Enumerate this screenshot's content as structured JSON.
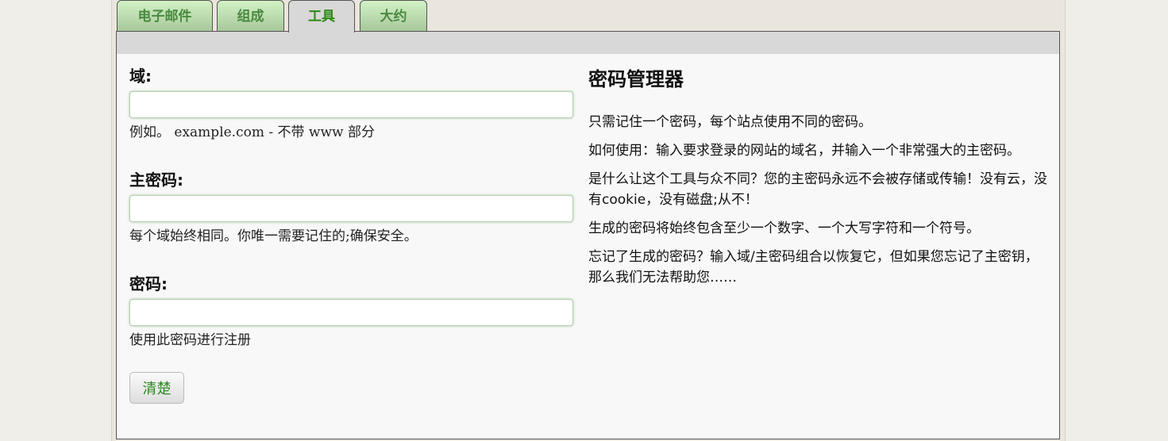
{
  "tabs": [
    {
      "label": "电子邮件"
    },
    {
      "label": "组成"
    },
    {
      "label": "工具",
      "active": true
    },
    {
      "label": "大约"
    }
  ],
  "form": {
    "domain_label": "域:",
    "domain_hint": "例如。 example.com - 不带 www 部分",
    "master_label": "主密码:",
    "master_hint": "每个域始终相同。你唯一需要记住的;确保安全。",
    "password_label": "密码:",
    "password_hint": "使用此密码进行注册",
    "clear_button": "清楚"
  },
  "info": {
    "title": "密码管理器",
    "paragraphs": [
      "只需记住一个密码，每个站点使用不同的密码。",
      "如何使用：输入要求登录的网站的域名，并输入一个非常强大的主密码。",
      "是什么让这个工具与众不同？您的主密码永远不会被存储或传输！没有云，没有cookie，没有磁盘;从不！",
      "生成的密码将始终包含至少一个数字、一个大写字符和一个符号。",
      "忘记了生成的密码？输入域/主密码组合以恢复它，但如果您忘记了主密钥，那么我们无法帮助您……"
    ]
  }
}
